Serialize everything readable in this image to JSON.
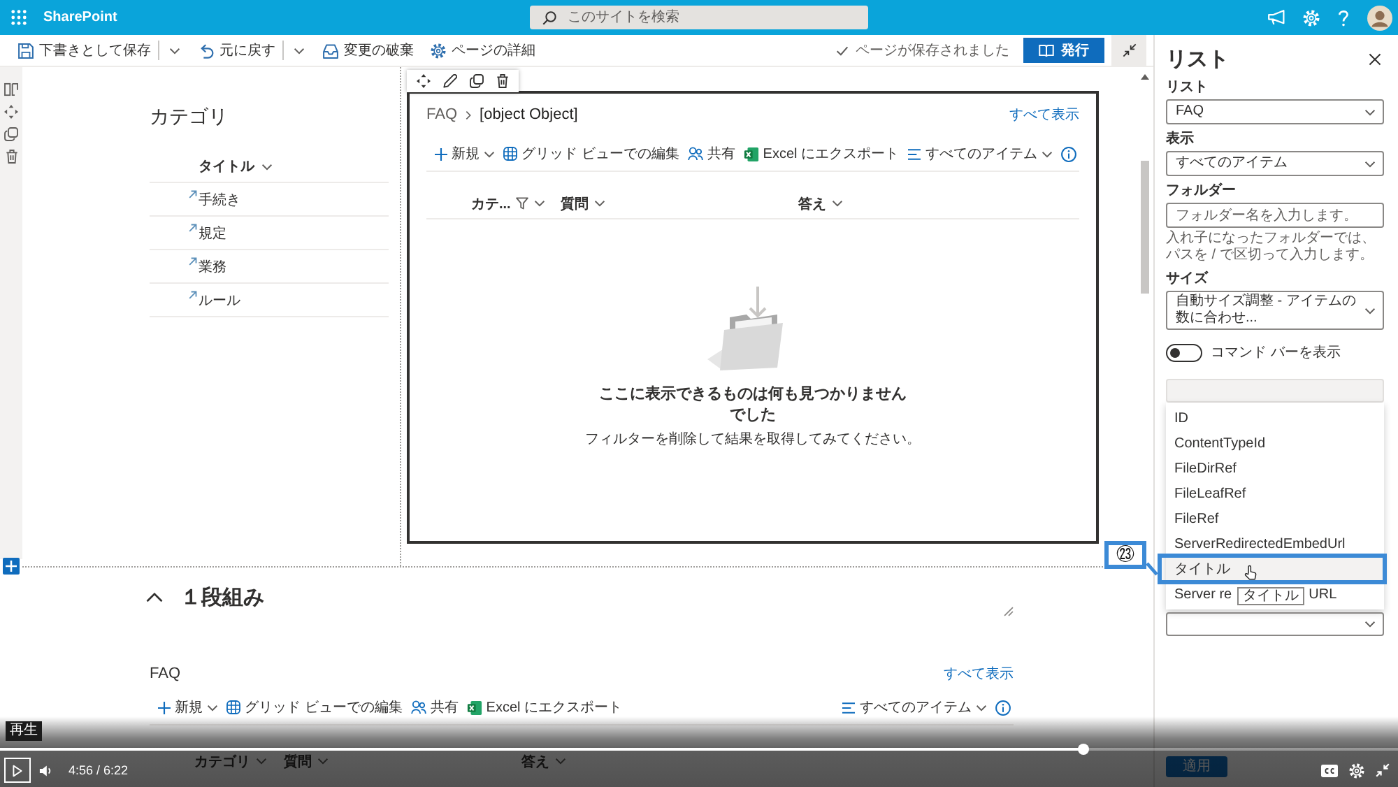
{
  "suite_bar": {
    "app_name": "SharePoint",
    "search": {
      "placeholder": "このサイトを検索"
    }
  },
  "command_bar": {
    "items": [
      {
        "kind": "save",
        "label": "下書きとして保存"
      },
      {
        "kind": "undo",
        "label": "元に戻す"
      },
      {
        "kind": "discard",
        "label": "変更の破棄"
      },
      {
        "kind": "details",
        "label": "ページの詳細"
      }
    ],
    "status": "ページが保存されました",
    "publish_button": "発行"
  },
  "section_1": {
    "left_column": {
      "title": "カテゴリ",
      "column_header": "タイトル",
      "rows": [
        "手続き",
        "規定",
        "業務",
        "ルール"
      ]
    },
    "web_part": {
      "selected": true,
      "breadcrumb": [
        "FAQ",
        "[object Object]"
      ],
      "see_all": "すべて表示",
      "toolbar": [
        {
          "kind": "new",
          "label": "新規"
        },
        {
          "kind": "grid",
          "label": "グリッド ビューでの編集"
        },
        {
          "kind": "share",
          "label": "共有"
        },
        {
          "kind": "excel",
          "label": "Excel にエクスポート"
        },
        {
          "kind": "view",
          "label": "すべてのアイテム"
        }
      ],
      "columns": [
        {
          "label": "カテ...",
          "filtered": true
        },
        {
          "label": "質問",
          "filtered": false
        },
        {
          "label": "答え",
          "filtered": false
        }
      ],
      "empty_title": "ここに表示できるものは何も見つかりませんでした",
      "empty_hint": "フィルターを削除して結果を取得してみてください。"
    }
  },
  "section_2": {
    "expanded": true,
    "title": "１段組み",
    "web_part": {
      "title": "FAQ",
      "see_all": "すべて表示",
      "toolbar": [
        {
          "kind": "new",
          "label": "新規"
        },
        {
          "kind": "grid",
          "label": "グリッド ビューでの編集"
        },
        {
          "kind": "share",
          "label": "共有"
        },
        {
          "kind": "excel",
          "label": "Excel にエクスポート"
        },
        {
          "kind": "view",
          "label": "すべてのアイテム"
        }
      ],
      "columns": [
        {
          "label": "カテゴリ",
          "filtered": false
        },
        {
          "label": "質問",
          "filtered": false
        },
        {
          "label": "答え",
          "filtered": false
        }
      ]
    }
  },
  "property_pane": {
    "title": "リスト",
    "fields": [
      {
        "kind": "dropdown",
        "label": "リスト",
        "value": "FAQ"
      },
      {
        "kind": "dropdown",
        "label": "表示",
        "value": "すべてのアイテム"
      },
      {
        "kind": "text",
        "label": "フォルダー",
        "placeholder": "フォルダー名を入力します。",
        "help": "入れ子になったフォルダーでは、パスを / で区切って入力します。"
      },
      {
        "kind": "dropdown",
        "label": "サイズ",
        "value": "自動サイズ調整 - アイテムの数に合わせ..."
      },
      {
        "kind": "toggle",
        "label": "コマンド バーを表示",
        "on": false
      }
    ],
    "field_picker": {
      "tooltip": "タイトル",
      "options": [
        {
          "label": "ID",
          "hovered": false
        },
        {
          "label": "ContentTypeId",
          "hovered": false
        },
        {
          "label": "FileDirRef",
          "hovered": false
        },
        {
          "label": "FileLeafRef",
          "hovered": false
        },
        {
          "label": "FileRef",
          "hovered": false
        },
        {
          "label": "ServerRedirectedEmbedUrl",
          "hovered": false
        },
        {
          "label": "タイトル",
          "hovered": true,
          "annotation": "㉓"
        },
        {
          "parts": [
            "Server re",
            "URL"
          ],
          "hovered": false
        }
      ]
    },
    "apply_button": "適用"
  },
  "video_player": {
    "tooltip": "再生",
    "level": 0.775,
    "time": "4:56 / 6:22"
  }
}
